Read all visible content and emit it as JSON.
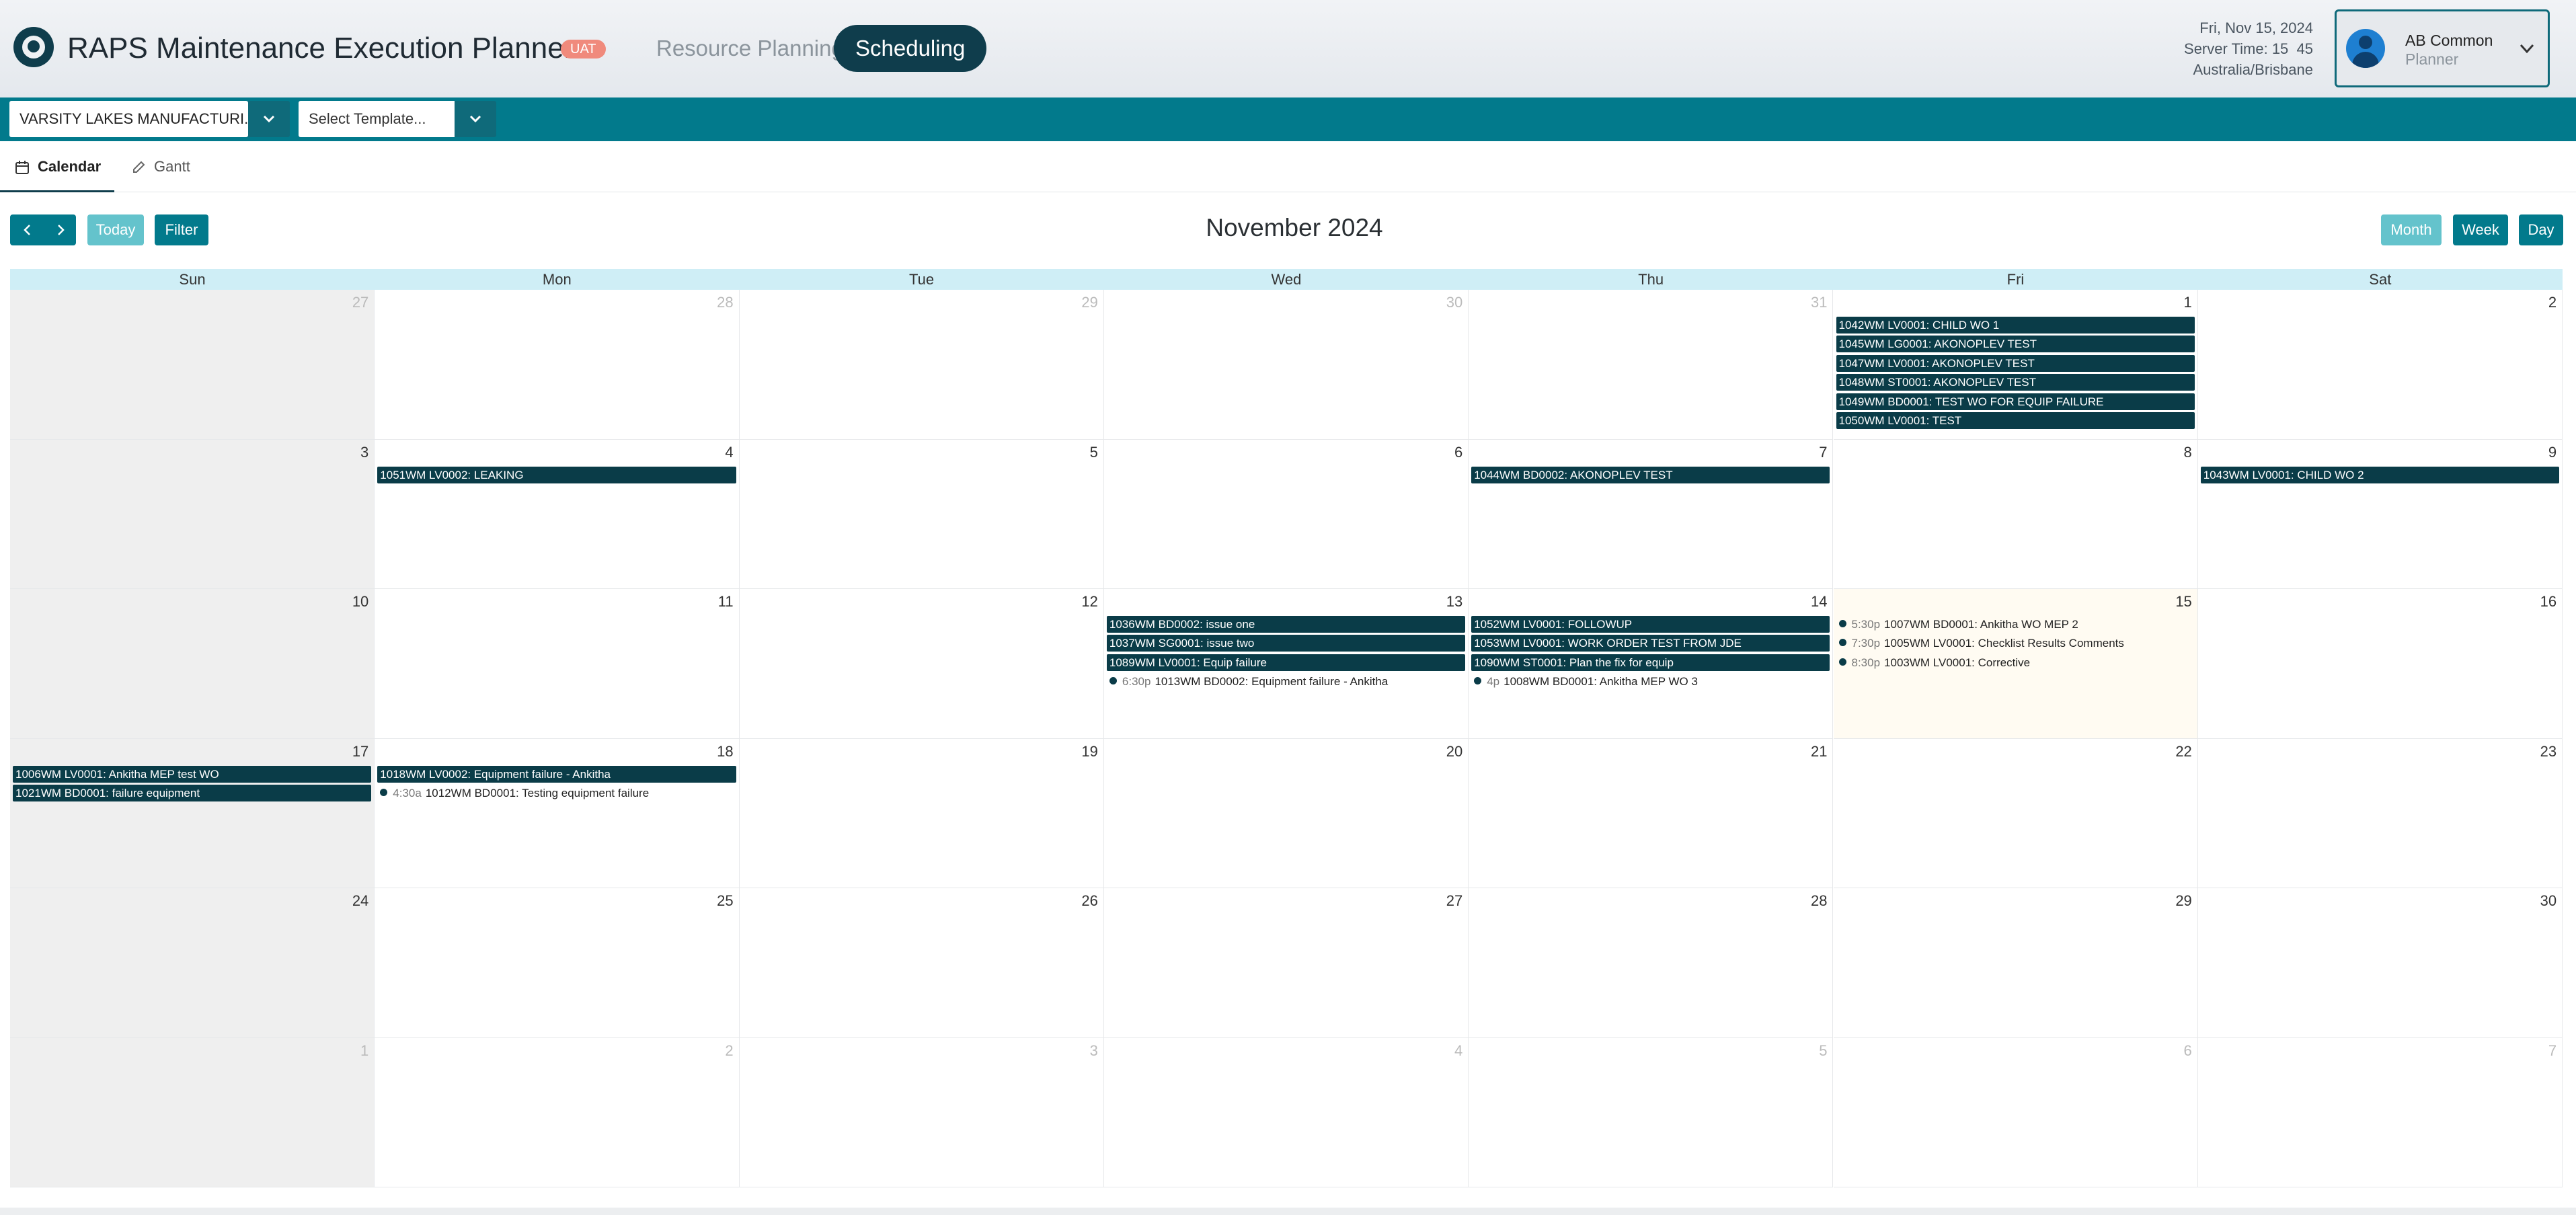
{
  "header": {
    "app_title": "RAPS Maintenance Execution Planner",
    "env_badge": "UAT",
    "nav": {
      "resource_planning": "Resource Planning",
      "scheduling": "Scheduling"
    },
    "date": "Fri, Nov 15, 2024",
    "server_time": "Server Time: 15  45",
    "timezone": "Australia/Brisbane",
    "user": {
      "name": "AB Common",
      "role": "Planner"
    }
  },
  "toolbar": {
    "plant": "VARSITY LAKES MANUFACTURI...",
    "template_placeholder": "Select Template..."
  },
  "view_tabs": {
    "calendar": "Calendar",
    "gantt": "Gantt"
  },
  "calendar_toolbar": {
    "today": "Today",
    "filter": "Filter",
    "title": "November 2024",
    "month": "Month",
    "week": "Week",
    "day": "Day"
  },
  "weekdays": [
    "Sun",
    "Mon",
    "Tue",
    "Wed",
    "Thu",
    "Fri",
    "Sat"
  ],
  "weeks": [
    [
      {
        "num": "27",
        "other": true,
        "events": []
      },
      {
        "num": "28",
        "other": true,
        "events": []
      },
      {
        "num": "29",
        "other": true,
        "events": []
      },
      {
        "num": "30",
        "other": true,
        "events": []
      },
      {
        "num": "31",
        "other": true,
        "events": []
      },
      {
        "num": "1",
        "events": [
          {
            "type": "bar",
            "text": "1042WM LV0001: CHILD WO 1"
          },
          {
            "type": "bar",
            "text": "1045WM LG0001: AKONOPLEV TEST"
          },
          {
            "type": "bar",
            "text": "1047WM LV0001: AKONOPLEV TEST"
          },
          {
            "type": "bar",
            "text": "1048WM ST0001: AKONOPLEV TEST"
          },
          {
            "type": "bar",
            "text": "1049WM BD0001: TEST WO FOR EQUIP FAILURE"
          },
          {
            "type": "bar",
            "text": "1050WM LV0001: TEST"
          }
        ]
      },
      {
        "num": "2",
        "events": []
      }
    ],
    [
      {
        "num": "3",
        "events": []
      },
      {
        "num": "4",
        "events": [
          {
            "type": "bar",
            "text": "1051WM LV0002: LEAKING"
          }
        ]
      },
      {
        "num": "5",
        "events": []
      },
      {
        "num": "6",
        "events": []
      },
      {
        "num": "7",
        "events": [
          {
            "type": "bar",
            "text": "1044WM BD0002: AKONOPLEV TEST"
          }
        ]
      },
      {
        "num": "8",
        "events": []
      },
      {
        "num": "9",
        "events": [
          {
            "type": "bar",
            "text": "1043WM LV0001: CHILD WO 2"
          }
        ]
      }
    ],
    [
      {
        "num": "10",
        "events": []
      },
      {
        "num": "11",
        "events": []
      },
      {
        "num": "12",
        "events": []
      },
      {
        "num": "13",
        "events": [
          {
            "type": "bar",
            "text": "1036WM BD0002: issue one"
          },
          {
            "type": "bar",
            "text": "1037WM SG0001: issue two"
          },
          {
            "type": "bar",
            "text": "1089WM LV0001: Equip failure"
          },
          {
            "type": "dot",
            "time": "6:30p",
            "text": "1013WM BD0002: Equipment failure - Ankitha"
          }
        ]
      },
      {
        "num": "14",
        "events": [
          {
            "type": "bar",
            "text": "1052WM LV0001: FOLLOWUP"
          },
          {
            "type": "bar",
            "text": "1053WM LV0001: WORK ORDER TEST FROM JDE"
          },
          {
            "type": "bar",
            "text": "1090WM ST0001: Plan the fix for equip"
          },
          {
            "type": "dot",
            "time": "4p",
            "text": "1008WM BD0001: Ankitha MEP WO 3"
          }
        ]
      },
      {
        "num": "15",
        "today": true,
        "events": [
          {
            "type": "dot",
            "time": "5:30p",
            "text": "1007WM BD0001: Ankitha WO MEP 2"
          },
          {
            "type": "dot",
            "time": "7:30p",
            "text": "1005WM LV0001: Checklist Results Comments"
          },
          {
            "type": "dot",
            "time": "8:30p",
            "text": "1003WM LV0001: Corrective"
          }
        ]
      },
      {
        "num": "16",
        "events": []
      }
    ],
    [
      {
        "num": "17",
        "events": [
          {
            "type": "bar",
            "text": "1006WM LV0001: Ankitha MEP test WO"
          },
          {
            "type": "bar",
            "text": "1021WM BD0001: failure equipment"
          }
        ]
      },
      {
        "num": "18",
        "events": [
          {
            "type": "bar",
            "text": "1018WM LV0002: Equipment failure - Ankitha"
          },
          {
            "type": "dot",
            "time": "4:30a",
            "text": "1012WM BD0001: Testing equipment failure"
          }
        ]
      },
      {
        "num": "19",
        "events": []
      },
      {
        "num": "20",
        "events": []
      },
      {
        "num": "21",
        "events": []
      },
      {
        "num": "22",
        "events": []
      },
      {
        "num": "23",
        "events": []
      }
    ],
    [
      {
        "num": "24",
        "events": []
      },
      {
        "num": "25",
        "events": []
      },
      {
        "num": "26",
        "events": []
      },
      {
        "num": "27",
        "events": []
      },
      {
        "num": "28",
        "events": []
      },
      {
        "num": "29",
        "events": []
      },
      {
        "num": "30",
        "events": []
      }
    ],
    [
      {
        "num": "1",
        "other": true,
        "events": []
      },
      {
        "num": "2",
        "other": true,
        "events": []
      },
      {
        "num": "3",
        "other": true,
        "events": []
      },
      {
        "num": "4",
        "other": true,
        "events": []
      },
      {
        "num": "5",
        "other": true,
        "events": []
      },
      {
        "num": "6",
        "other": true,
        "events": []
      },
      {
        "num": "7",
        "other": true,
        "events": []
      }
    ]
  ]
}
